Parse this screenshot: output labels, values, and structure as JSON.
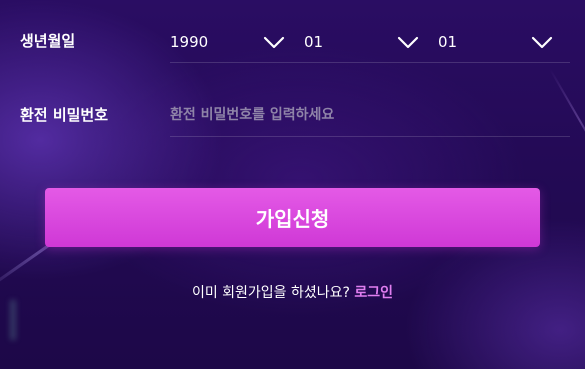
{
  "birthdate": {
    "label": "생년월일",
    "year": "1990",
    "month": "01",
    "day": "01",
    "chevron_icon": "chevron-down-icon"
  },
  "transfer_password": {
    "label": "환전 비밀번호",
    "placeholder": "환전 비밀번호를 입력하세요",
    "value": ""
  },
  "submit": {
    "label": "가입신청",
    "color": "#d944de"
  },
  "footer": {
    "prompt": "이미 회원가입을 하셨나요?",
    "login_link": "로그인",
    "link_color": "#e07ef0"
  },
  "colors": {
    "background": "#230a55",
    "accent": "#d944de"
  }
}
